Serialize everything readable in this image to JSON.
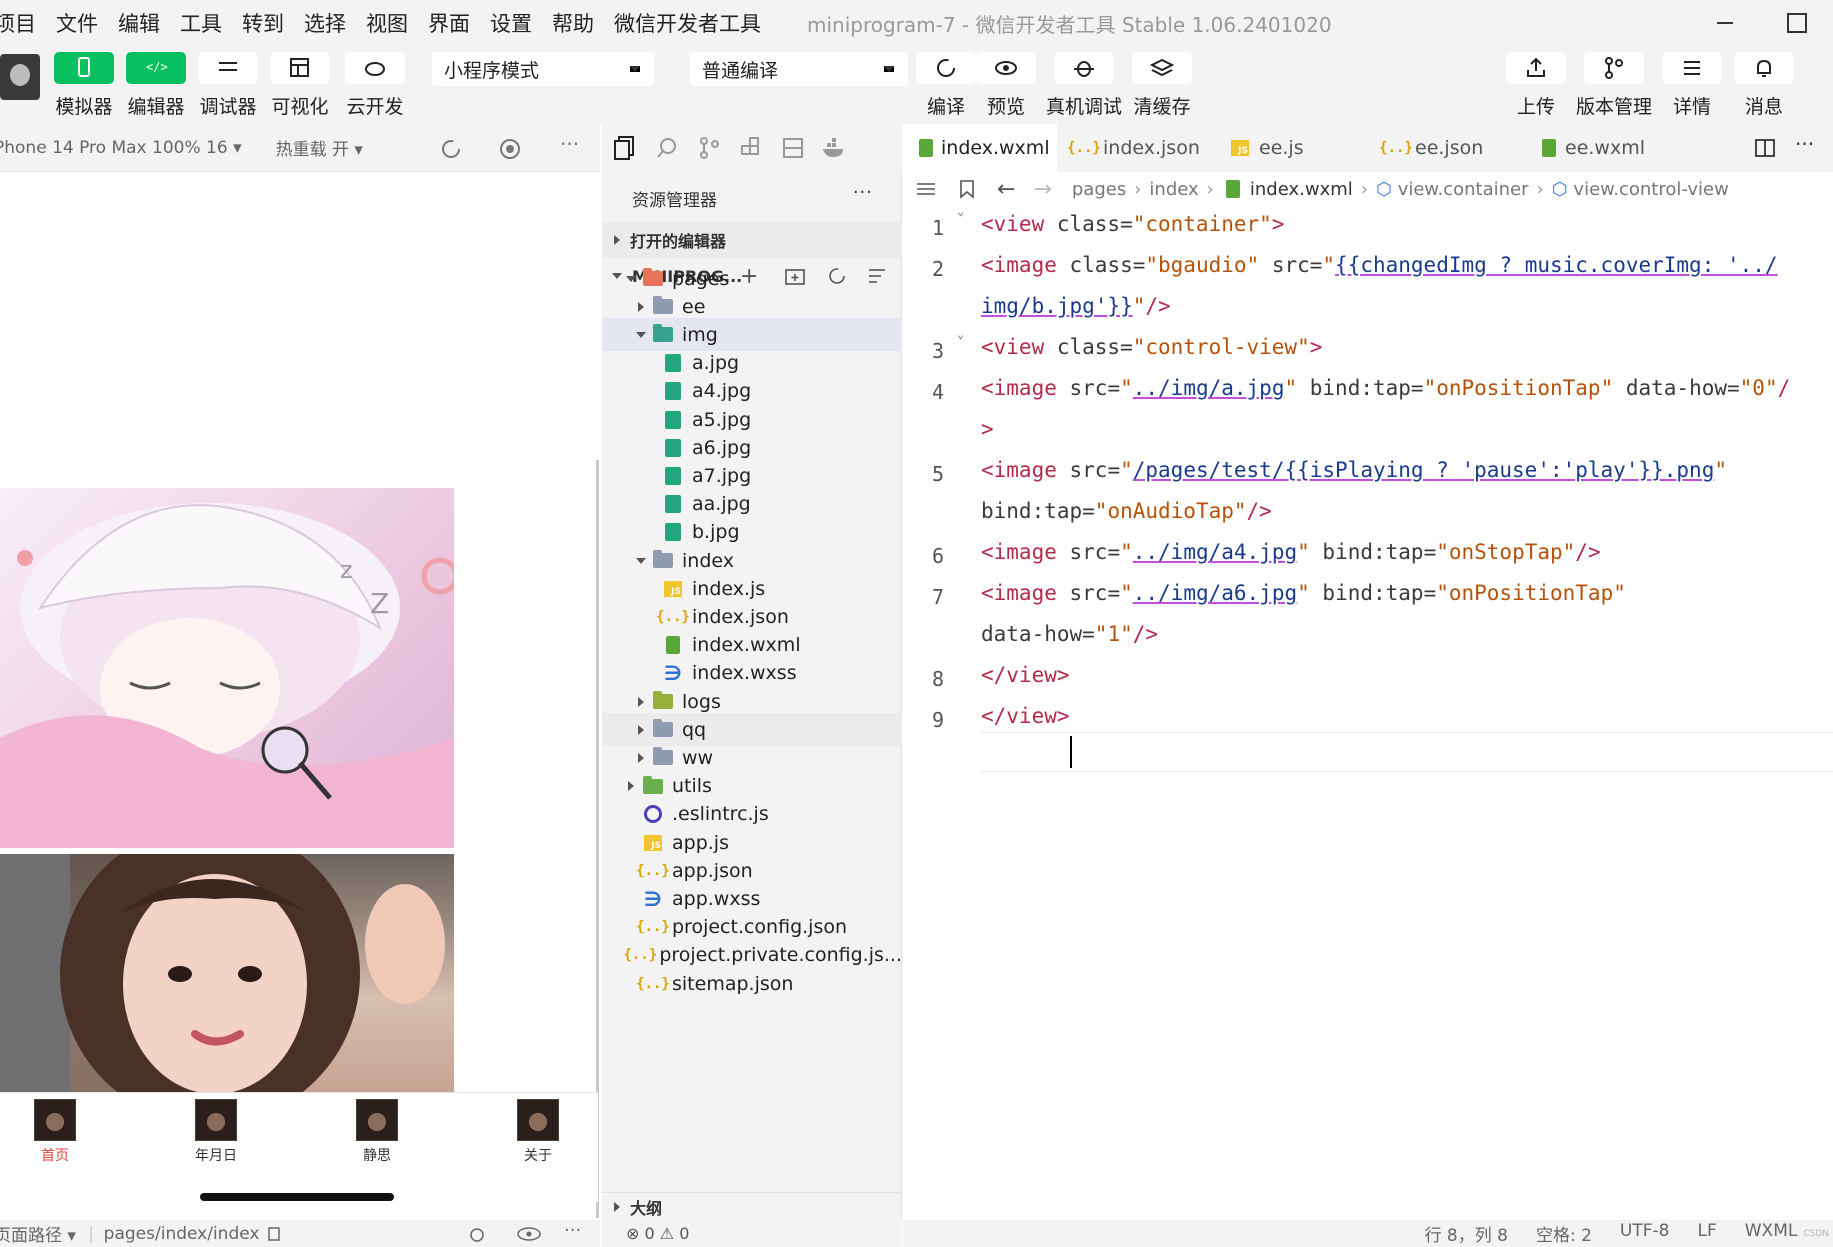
{
  "menu": [
    "项目",
    "文件",
    "编辑",
    "工具",
    "转到",
    "选择",
    "视图",
    "界面",
    "设置",
    "帮助",
    "微信开发者工具"
  ],
  "app_title": "miniprogram-7 - 微信开发者工具 Stable 1.06.2401020",
  "toolbar": {
    "left_buttons": [
      {
        "label": "模拟器",
        "icon": "phone-icon"
      },
      {
        "label": "编辑器",
        "icon": "code-icon"
      },
      {
        "label": "调试器",
        "icon": "debug-icon"
      },
      {
        "label": "可视化",
        "icon": "layout-icon"
      },
      {
        "label": "云开发",
        "icon": "cloud-icon"
      }
    ],
    "mode_select": "小程序模式",
    "compile_select": "普通编译",
    "mid_buttons": [
      {
        "label": "编译",
        "icon": "refresh-icon"
      },
      {
        "label": "预览",
        "icon": "eye-icon"
      },
      {
        "label": "真机调试",
        "icon": "bug-icon"
      },
      {
        "label": "清缓存",
        "icon": "layers-icon"
      }
    ],
    "right_buttons": [
      {
        "label": "上传",
        "icon": "upload-icon"
      },
      {
        "label": "版本管理",
        "icon": "branch-icon"
      },
      {
        "label": "详情",
        "icon": "menu-icon"
      },
      {
        "label": "消息",
        "icon": "bell-icon"
      }
    ]
  },
  "simulator": {
    "device": "Phone 14 Pro Max 100% 16 ▾",
    "hot_reload": "热重载 开 ▾",
    "tabs": [
      {
        "label": "首页",
        "active": true
      },
      {
        "label": "年月日",
        "active": false
      },
      {
        "label": "静思",
        "active": false
      },
      {
        "label": "关于",
        "active": false
      }
    ],
    "footer_path_label": "页面路径 ▾",
    "footer_path": "pages/index/index"
  },
  "explorer": {
    "title": "资源管理器",
    "more": "···",
    "open_editors": "打开的编辑器",
    "project": "MINIPROG...",
    "outline": "大纲",
    "tree": [
      {
        "label": "pages",
        "depth": 1,
        "type": "folder-red",
        "twisty": "down"
      },
      {
        "label": "ee",
        "depth": 2,
        "type": "folder",
        "twisty": "right"
      },
      {
        "label": "img",
        "depth": 2,
        "type": "folder-teal",
        "twisty": "down",
        "selected": true
      },
      {
        "label": "a.jpg",
        "depth": 3,
        "type": "img"
      },
      {
        "label": "a4.jpg",
        "depth": 3,
        "type": "img"
      },
      {
        "label": "a5.jpg",
        "depth": 3,
        "type": "img"
      },
      {
        "label": "a6.jpg",
        "depth": 3,
        "type": "img"
      },
      {
        "label": "a7.jpg",
        "depth": 3,
        "type": "img"
      },
      {
        "label": "aa.jpg",
        "depth": 3,
        "type": "img"
      },
      {
        "label": "b.jpg",
        "depth": 3,
        "type": "img"
      },
      {
        "label": "index",
        "depth": 2,
        "type": "folder",
        "twisty": "down"
      },
      {
        "label": "index.js",
        "depth": 3,
        "type": "js"
      },
      {
        "label": "index.json",
        "depth": 3,
        "type": "json"
      },
      {
        "label": "index.wxml",
        "depth": 3,
        "type": "wxml"
      },
      {
        "label": "index.wxss",
        "depth": 3,
        "type": "wxss"
      },
      {
        "label": "logs",
        "depth": 2,
        "type": "folder-olive",
        "twisty": "right"
      },
      {
        "label": "qq",
        "depth": 2,
        "type": "folder",
        "twisty": "right",
        "hover": true
      },
      {
        "label": "ww",
        "depth": 2,
        "type": "folder",
        "twisty": "right"
      },
      {
        "label": "utils",
        "depth": 1,
        "type": "folder-lime",
        "twisty": "right"
      },
      {
        "label": ".eslintrc.js",
        "depth": 1,
        "type": "eslint"
      },
      {
        "label": "app.js",
        "depth": 1,
        "type": "js"
      },
      {
        "label": "app.json",
        "depth": 1,
        "type": "json"
      },
      {
        "label": "app.wxss",
        "depth": 1,
        "type": "wxss"
      },
      {
        "label": "project.config.json",
        "depth": 1,
        "type": "json"
      },
      {
        "label": "project.private.config.js...",
        "depth": 1,
        "type": "json"
      },
      {
        "label": "sitemap.json",
        "depth": 1,
        "type": "json"
      }
    ],
    "problems": "⊗ 0 ⚠ 0"
  },
  "editor": {
    "tabs": [
      {
        "label": "index.wxml",
        "type": "wxml",
        "active": true
      },
      {
        "label": "index.json",
        "type": "json"
      },
      {
        "label": "ee.js",
        "type": "js"
      },
      {
        "label": "ee.json",
        "type": "json"
      },
      {
        "label": "ee.wxml",
        "type": "wxml"
      }
    ],
    "breadcrumb": [
      "pages",
      "index",
      "index.wxml",
      "view.container",
      "view.control-view"
    ],
    "lines": [
      {
        "num": "1",
        "fold": true,
        "rows": [
          [
            [
              "t",
              "<view "
            ],
            [
              "a",
              "class="
            ],
            [
              "s",
              "\"container\""
            ],
            [
              "t",
              ">"
            ]
          ]
        ]
      },
      {
        "num": "2",
        "rows": [
          [
            [
              "t",
              "<image "
            ],
            [
              "a",
              "class="
            ],
            [
              "s",
              "\"bgaudio\" "
            ],
            [
              "a",
              "src="
            ],
            [
              "s",
              "\""
            ],
            [
              "m",
              "{{changedImg ? music.coverImg: '../"
            ]
          ],
          [
            [
              "m",
              "img/b.jpg'}}"
            ],
            [
              "s",
              "\""
            ],
            [
              "t",
              "/>"
            ]
          ]
        ]
      },
      {
        "num": "3",
        "fold": true,
        "rows": [
          [
            [
              "t",
              "<view "
            ],
            [
              "a",
              "class="
            ],
            [
              "s",
              "\"control-view\""
            ],
            [
              "t",
              ">"
            ]
          ]
        ]
      },
      {
        "num": "4",
        "rows": [
          [
            [
              "t",
              "<image "
            ],
            [
              "a",
              "src="
            ],
            [
              "s",
              "\""
            ],
            [
              "m",
              "../img/a.jpg"
            ],
            [
              "s",
              "\" "
            ],
            [
              "a",
              "bind:tap="
            ],
            [
              "s",
              "\"onPositionTap\" "
            ],
            [
              "a",
              "data-how="
            ],
            [
              "s",
              "\"0\""
            ],
            [
              "t",
              "/"
            ]
          ],
          [
            [
              "t",
              ">"
            ]
          ]
        ]
      },
      {
        "num": "5",
        "rows": [
          [
            [
              "t",
              "<image "
            ],
            [
              "a",
              "src="
            ],
            [
              "s",
              "\""
            ],
            [
              "m",
              "/pages/test/{{isPlaying ? 'pause':'play'}}.png"
            ],
            [
              "s",
              "\""
            ]
          ],
          [
            [
              "a",
              "bind:tap="
            ],
            [
              "s",
              "\"onAudioTap\""
            ],
            [
              "t",
              "/>"
            ]
          ]
        ]
      },
      {
        "num": "6",
        "rows": [
          [
            [
              "t",
              "<image "
            ],
            [
              "a",
              "src="
            ],
            [
              "s",
              "\""
            ],
            [
              "m",
              "../img/a4.jpg"
            ],
            [
              "s",
              "\" "
            ],
            [
              "a",
              "bind:tap="
            ],
            [
              "s",
              "\"onStopTap\""
            ],
            [
              "t",
              "/>"
            ]
          ]
        ]
      },
      {
        "num": "7",
        "rows": [
          [
            [
              "t",
              "<image "
            ],
            [
              "a",
              "src="
            ],
            [
              "s",
              "\""
            ],
            [
              "m",
              "../img/a6.jpg"
            ],
            [
              "s",
              "\" "
            ],
            [
              "a",
              "bind:tap="
            ],
            [
              "s",
              "\"onPositionTap\""
            ]
          ],
          [
            [
              "a",
              "data-how="
            ],
            [
              "s",
              "\"1\""
            ],
            [
              "t",
              "/>"
            ]
          ]
        ]
      },
      {
        "num": "8",
        "rows": [
          [
            [
              "t",
              "</view>"
            ]
          ]
        ]
      },
      {
        "num": "9",
        "rows": [
          [
            [
              "t",
              "</view>"
            ]
          ]
        ]
      }
    ],
    "status": [
      "行 8，列 8",
      "空格: 2",
      "UTF-8",
      "LF",
      "WXML"
    ]
  },
  "colors": {
    "accent_green": "#07c160",
    "tag": "#b5294a",
    "string": "#b5520a",
    "link": "#1a3b8c"
  }
}
